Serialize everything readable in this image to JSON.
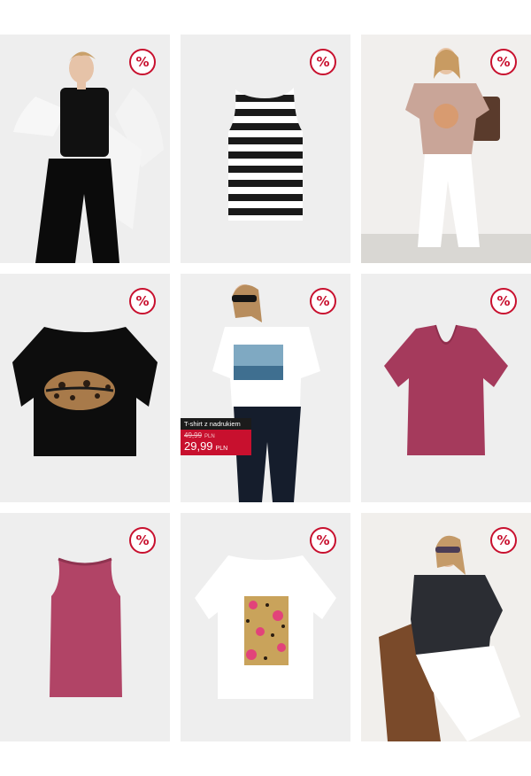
{
  "badge_symbol": "%",
  "accent_color": "#c8102e",
  "products": [
    {
      "id": "p1",
      "image": "woman-black-knit-top-white-shirt"
    },
    {
      "id": "p2",
      "image": "black-white-striped-tank-top"
    },
    {
      "id": "p3",
      "image": "woman-beige-graphic-tshirt-white-jeans"
    },
    {
      "id": "p4",
      "image": "black-crop-tshirt-leopard-lips-print"
    },
    {
      "id": "p5",
      "image": "woman-white-printed-tshirt-sunglasses",
      "price_tag": {
        "name": "T-shirt z nadrukiem",
        "old_price": "49,99",
        "new_price": "29,99",
        "currency": "PLN"
      }
    },
    {
      "id": "p6",
      "image": "raspberry-vneck-tshirt"
    },
    {
      "id": "p7",
      "image": "raspberry-sleeveless-top"
    },
    {
      "id": "p8",
      "image": "white-tshirt-leopard-floral-print"
    },
    {
      "id": "p9",
      "image": "woman-black-vneck-top-chair"
    }
  ]
}
